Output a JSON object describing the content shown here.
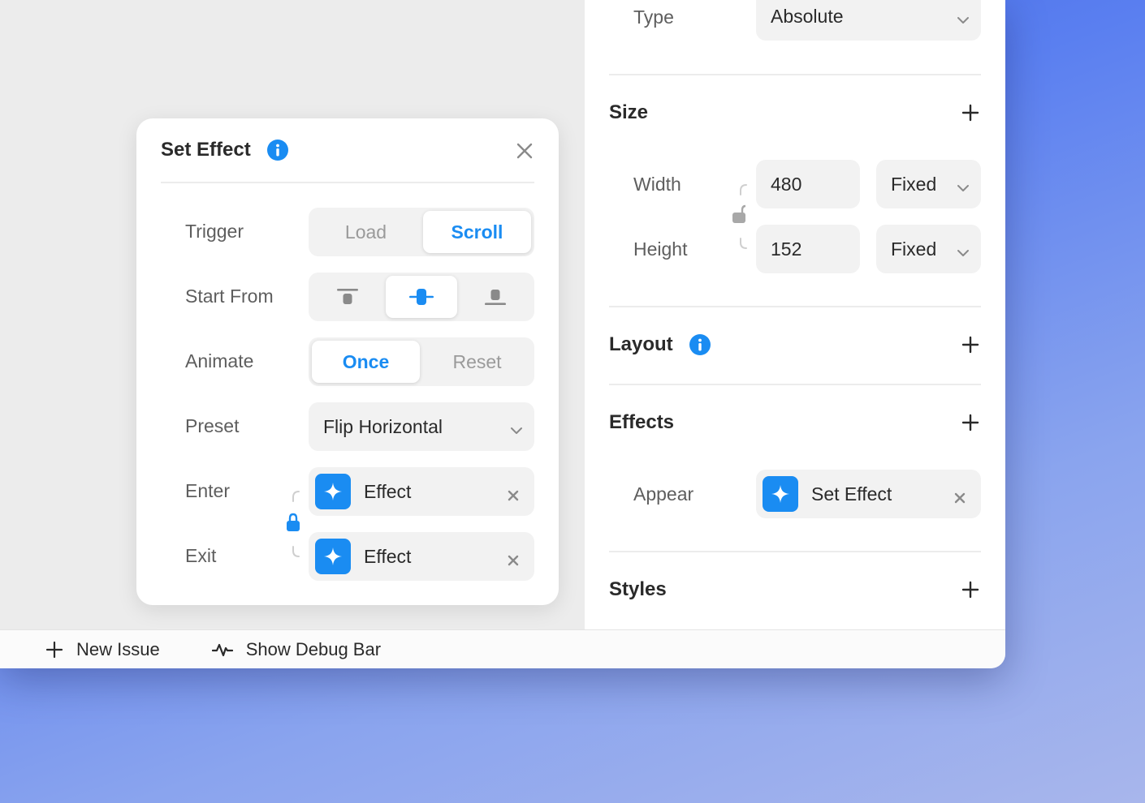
{
  "dialog": {
    "title": "Set Effect",
    "rows": {
      "trigger": {
        "label": "Trigger",
        "options": [
          "Load",
          "Scroll"
        ],
        "selected": "Scroll"
      },
      "start_from": {
        "label": "Start From",
        "selected": "center"
      },
      "animate": {
        "label": "Animate",
        "options": [
          "Once",
          "Reset"
        ],
        "selected": "Once"
      },
      "preset": {
        "label": "Preset",
        "value": "Flip Horizontal"
      },
      "enter": {
        "label": "Enter",
        "value": "Effect"
      },
      "exit": {
        "label": "Exit",
        "value": "Effect"
      }
    }
  },
  "inspector": {
    "type": {
      "label": "Type",
      "value": "Absolute"
    },
    "size": {
      "title": "Size",
      "width": {
        "label": "Width",
        "value": "480",
        "mode": "Fixed"
      },
      "height": {
        "label": "Height",
        "value": "152",
        "mode": "Fixed"
      }
    },
    "layout": {
      "title": "Layout"
    },
    "effects": {
      "title": "Effects",
      "appear": {
        "label": "Appear",
        "value": "Set Effect"
      }
    },
    "styles": {
      "title": "Styles"
    }
  },
  "bottombar": {
    "new_issue": "New Issue",
    "debug": "Show Debug Bar"
  },
  "colors": {
    "accent": "#1a8cf2",
    "panel": "#ffffff",
    "field": "#f2f2f2",
    "canvas": "#ececec"
  }
}
